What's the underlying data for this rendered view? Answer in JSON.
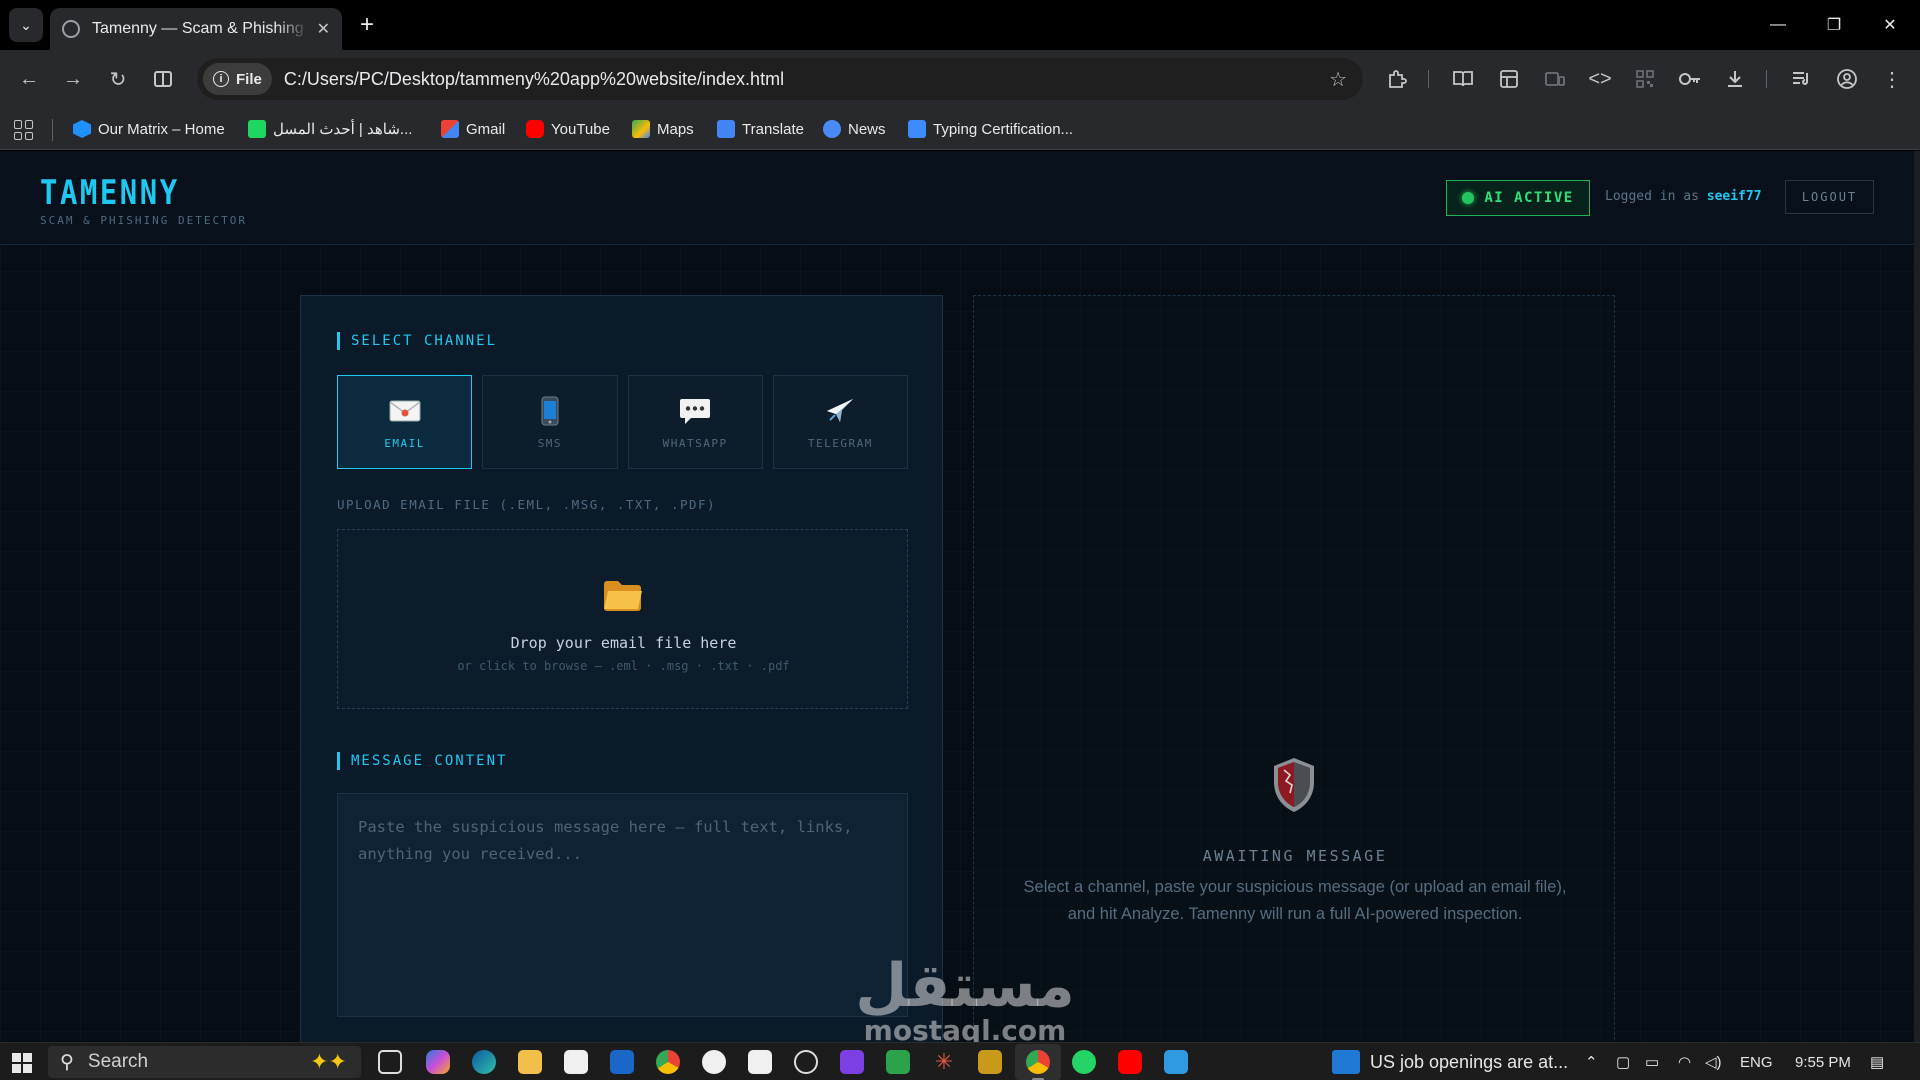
{
  "browser": {
    "tab_title": "Tamenny — Scam & Phishing Detector",
    "url_chip": "File",
    "url": "C:/Users/PC/Desktop/tammeny%20app%20website/index.html",
    "bookmarks": [
      {
        "label": "Our Matrix – Home",
        "color": "#1e90ff"
      },
      {
        "label": "شاهد | أحدث المسل...",
        "color": "#1ed760"
      },
      {
        "label": "Gmail",
        "color": "#ea4335"
      },
      {
        "label": "YouTube",
        "color": "#ff0000"
      },
      {
        "label": "Maps",
        "color": "#34a853"
      },
      {
        "label": "Translate",
        "color": "#4285f4"
      },
      {
        "label": "News",
        "color": "#4a8af4"
      },
      {
        "label": "Typing Certification...",
        "color": "#3d8bfd"
      }
    ]
  },
  "app": {
    "logo": "TAMENNY",
    "tagline": "SCAM & PHISHING DETECTOR",
    "status_badge": "AI ACTIVE",
    "logged_in_prefix": "Logged in as",
    "username": "seeif77",
    "logout_label": "LOGOUT",
    "accent_color": "#1ec8f0",
    "status_color": "#22c55e"
  },
  "left_panel": {
    "channel_title": "SELECT CHANNEL",
    "channels": [
      {
        "label": "EMAIL",
        "icon": "envelope-icon",
        "active": true
      },
      {
        "label": "SMS",
        "icon": "mobile-phone-icon",
        "active": false
      },
      {
        "label": "WHATSAPP",
        "icon": "speech-bubble-icon",
        "active": false
      },
      {
        "label": "TELEGRAM",
        "icon": "airplane-icon",
        "active": false
      }
    ],
    "upload_label": "UPLOAD EMAIL FILE (.EML, .MSG, .TXT, .PDF)",
    "drop_title": "Drop your email file here",
    "drop_subtitle": "or click to browse — .eml · .msg · .txt · .pdf",
    "message_title": "MESSAGE CONTENT",
    "message_placeholder": "Paste the suspicious message here — full text, links, anything you received..."
  },
  "right_panel": {
    "await_title": "AWAITING MESSAGE",
    "await_description": "Select a channel, paste your suspicious message (or upload an email file), and hit Analyze. Tamenny will run a full AI-powered inspection."
  },
  "watermark": {
    "arabic": "مستقل",
    "latin": "mostaql.com"
  },
  "taskbar": {
    "search_label": "Search",
    "news_text": "US job openings are at...",
    "language": "ENG",
    "time": "9:55 PM"
  }
}
